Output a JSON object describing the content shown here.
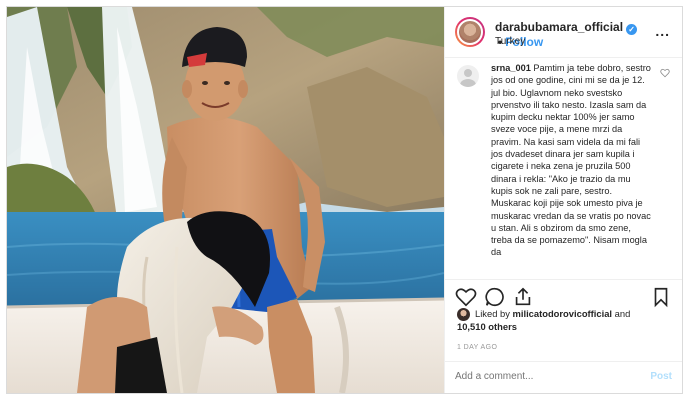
{
  "header": {
    "username": "darabubamara_official",
    "follow_label": "Follow",
    "separator": "•",
    "location": "Turkey",
    "more_label": "..."
  },
  "comment": {
    "user": "srna_001",
    "text": "Pamtim ja tebe dobro, sestro jos od one godine, cini mi se da je 12. jul bio. Uglavnom neko svestsko prvenstvo ili tako nesto. Izasla sam da kupim decku nektar 100% jer samo sveze voce pije, a mene mrzi da pravim. Na kasi sam videla da mi fali jos dvadeset dinara jer sam kupila i cigarete i neka zena je pruzila 500 dinara i rekla: \"Ako je trazio da mu kupis sok ne zali pare, sestro. Muskarac koji pije sok umesto piva je muskarac vredan da se vratis po novac u stan. Ali s obzirom da smo zene, treba da se pomazemo\". Nisam mogla da",
    "heart_icon": "heart-outline-icon"
  },
  "likes": {
    "prefix": "Liked by",
    "user": "milicatodorovicofficial",
    "and": "and",
    "count": "10,510 others"
  },
  "timestamp": "1 DAY AGO",
  "add_comment": {
    "placeholder": "Add a comment...",
    "post_label": "Post"
  },
  "colors": {
    "accent": "#3897f0",
    "post_disabled": "#b2dffc",
    "border": "#efefef"
  }
}
